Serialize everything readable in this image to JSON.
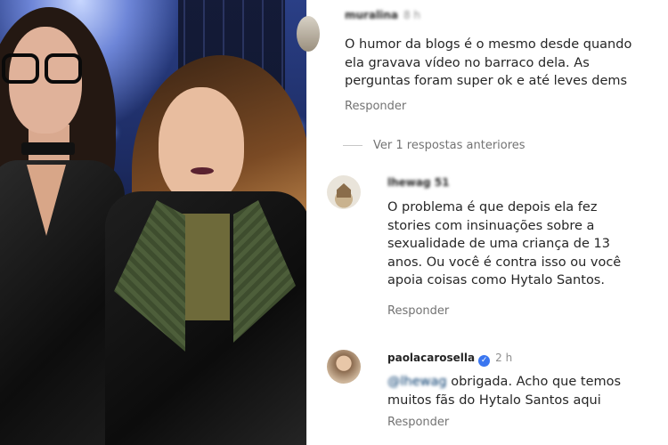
{
  "comments": [
    {
      "username": "muralina",
      "time": "8 h",
      "text_lines": [
        "O humor da blogs é o mesmo desde quando",
        "ela gravava vídeo no barraco dela. As",
        "perguntas foram super ok e até leves dems"
      ],
      "reply_label": "Responder"
    },
    {
      "username": "lhewag 51",
      "text_lines": [
        "O problema é que depois ela fez",
        "stories com insinuações sobre a",
        "sexualidade de uma criança de 13",
        "anos. Ou você é contra isso ou você",
        "apoia coisas como Hytalo Santos."
      ],
      "reply_label": "Responder"
    },
    {
      "username": "paolacarosella",
      "time": "2 h",
      "verified_icon": "✓",
      "mention": "@lhewag",
      "text_first_line_rest": " obrigada. Acho que temos",
      "text_lines": [
        "muitos fãs do Hytalo Santos aqui"
      ],
      "reply_label": "Responder"
    }
  ],
  "view_previous_replies": "Ver 1 respostas anteriores",
  "colors": {
    "text": "#262626",
    "secondary": "#737373",
    "verified": "#3a76f0",
    "mention": "#00376b"
  }
}
